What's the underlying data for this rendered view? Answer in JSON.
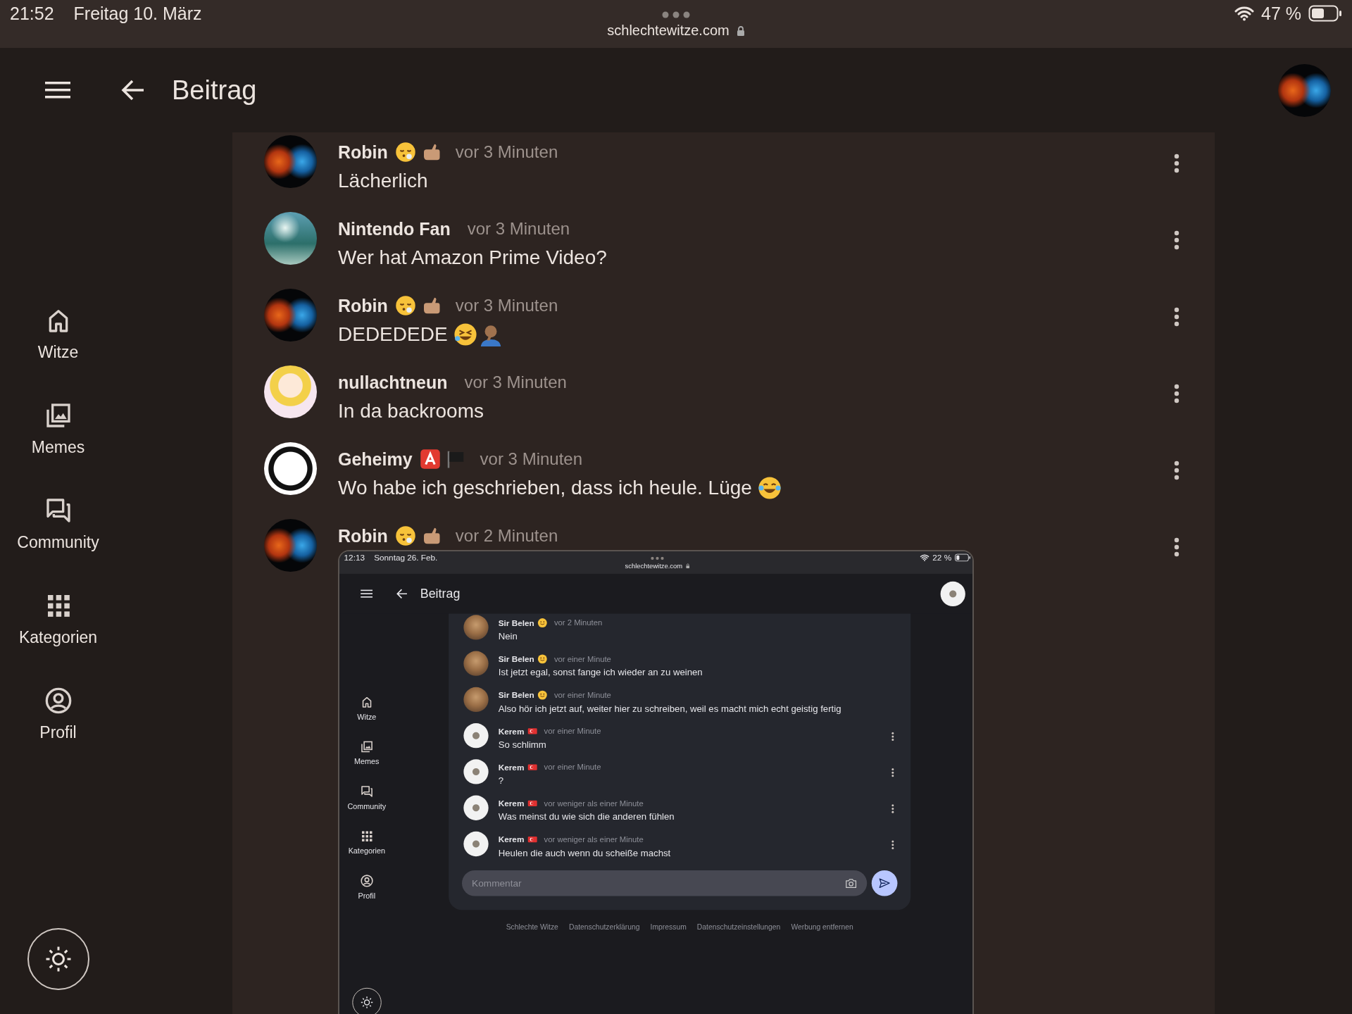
{
  "status_bar": {
    "time": "21:52",
    "date": "Freitag 10. März",
    "url": "schlechtewitze.com",
    "battery": "47 %"
  },
  "header": {
    "title": "Beitrag",
    "avatar": {
      "kind": "fire-water"
    }
  },
  "nav": [
    {
      "label": "Witze",
      "kind": "home"
    },
    {
      "label": "Memes",
      "kind": "photos"
    },
    {
      "label": "Community",
      "kind": "forum"
    },
    {
      "label": "Kategorien",
      "kind": "grid"
    },
    {
      "label": "Profil",
      "kind": "account"
    }
  ],
  "comments": [
    {
      "author": "Robin",
      "emojis": [
        {
          "kind": "exhale"
        },
        {
          "kind": "hand"
        }
      ],
      "time": "vor 3 Minuten",
      "text": "Lächerlich",
      "avatar": {
        "kind": "fire-water"
      },
      "menu": true
    },
    {
      "author": "Nintendo Fan",
      "time": "vor 3 Minuten",
      "text": "Wer hat Amazon Prime Video?",
      "avatar": {
        "kind": "landscape"
      },
      "menu": true
    },
    {
      "author": "Robin",
      "emojis": [
        {
          "kind": "exhale"
        },
        {
          "kind": "hand"
        }
      ],
      "time": "vor 3 Minuten",
      "text": "DEDEDEDE",
      "text_emojis": [
        {
          "kind": "rofl"
        },
        {
          "kind": "facepalm"
        }
      ],
      "avatar": {
        "kind": "fire-water"
      },
      "menu": true
    },
    {
      "author": "nullachtneun",
      "time": "vor 3 Minuten",
      "text": "In da backrooms",
      "avatar": {
        "kind": "cartoon"
      },
      "menu": true
    },
    {
      "author": "Geheimy",
      "emojis": [
        {
          "kind": "a-square"
        },
        {
          "kind": "black-flag"
        }
      ],
      "time": "vor 3 Minuten",
      "text": "Wo habe ich geschrieben, dass ich heule. Lüge",
      "text_emojis": [
        {
          "kind": "joy"
        }
      ],
      "avatar": {
        "kind": "emblem"
      },
      "menu": true
    },
    {
      "author": "Robin",
      "emojis": [
        {
          "kind": "exhale"
        },
        {
          "kind": "hand"
        }
      ],
      "time": "vor 2 Minuten",
      "avatar": {
        "kind": "fire-water"
      },
      "menu": true,
      "attachment": {
        "status_bar": {
          "time": "12:13",
          "date": "Sonntag 26. Feb.",
          "url": "schlechtewitze.com",
          "battery": "22 %"
        },
        "header": {
          "title": "Beitrag",
          "avatar": {
            "kind": "bird"
          }
        },
        "nav": [
          {
            "label": "Witze",
            "kind": "home"
          },
          {
            "label": "Memes",
            "kind": "photos"
          },
          {
            "label": "Community",
            "kind": "forum"
          },
          {
            "label": "Kategorien",
            "kind": "grid"
          },
          {
            "label": "Profil",
            "kind": "account"
          }
        ],
        "comments": [
          {
            "author": "Sir Belen",
            "emojis": [
              {
                "kind": "smile"
              }
            ],
            "time": "vor 2 Minuten",
            "text": "Nein",
            "avatar": {
              "kind": "portrait"
            },
            "menu": false
          },
          {
            "author": "Sir Belen",
            "emojis": [
              {
                "kind": "smile"
              }
            ],
            "time": "vor einer Minute",
            "text": "Ist jetzt egal, sonst fange ich wieder an zu weinen",
            "avatar": {
              "kind": "portrait"
            },
            "menu": false
          },
          {
            "author": "Sir Belen",
            "emojis": [
              {
                "kind": "smile"
              }
            ],
            "time": "vor einer Minute",
            "text": "Also hör ich jetzt auf, weiter hier zu schreiben, weil es macht mich echt geistig fertig",
            "avatar": {
              "kind": "portrait"
            },
            "menu": false
          },
          {
            "author": "Kerem",
            "emojis": [
              {
                "kind": "tr-flag"
              }
            ],
            "time": "vor einer Minute",
            "text": "So schlimm",
            "avatar": {
              "kind": "bird"
            },
            "menu": true
          },
          {
            "author": "Kerem",
            "emojis": [
              {
                "kind": "tr-flag"
              }
            ],
            "time": "vor einer Minute",
            "text": "?",
            "avatar": {
              "kind": "bird"
            },
            "menu": true
          },
          {
            "author": "Kerem",
            "emojis": [
              {
                "kind": "tr-flag"
              }
            ],
            "time": "vor weniger als einer Minute",
            "text": "Was meinst du wie sich die anderen fühlen",
            "avatar": {
              "kind": "bird"
            },
            "menu": true
          },
          {
            "author": "Kerem",
            "emojis": [
              {
                "kind": "tr-flag"
              }
            ],
            "time": "vor weniger als einer Minute",
            "text": "Heulen die auch wenn du scheiße machst",
            "avatar": {
              "kind": "bird"
            },
            "menu": true
          }
        ],
        "comment_field": {
          "placeholder": "Kommentar"
        },
        "footer_links": [
          "Schlechte Witze",
          "Datenschutzerklärung",
          "Impressum",
          "Datenschutzeinstellungen",
          "Werbung entfernen"
        ]
      }
    }
  ]
}
